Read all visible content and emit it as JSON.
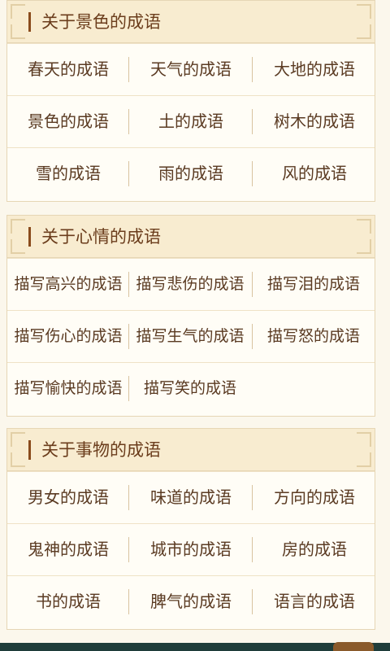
{
  "sections": [
    {
      "title": "关于景色的成语",
      "rows": [
        [
          "春天的成语",
          "天气的成语",
          "大地的成语"
        ],
        [
          "景色的成语",
          "土的成语",
          "树木的成语"
        ],
        [
          "雪的成语",
          "雨的成语",
          "风的成语"
        ]
      ]
    },
    {
      "title": "关于心情的成语",
      "rows": [
        [
          "描写高兴的成语",
          "描写悲伤的成语",
          "描写泪的成语"
        ],
        [
          "描写伤心的成语",
          "描写生气的成语",
          "描写怒的成语"
        ],
        [
          "描写愉快的成语",
          "描写笑的成语",
          ""
        ]
      ]
    },
    {
      "title": "关于事物的成语",
      "rows": [
        [
          "男女的成语",
          "味道的成语",
          "方向的成语"
        ],
        [
          "鬼神的成语",
          "城市的成语",
          "房的成语"
        ],
        [
          "书的成语",
          "脾气的成语",
          "语言的成语"
        ]
      ]
    }
  ],
  "colors": {
    "background": "#fbf7ec",
    "header_bg": "#f8ecd0",
    "title_text": "#6b3d1c",
    "accent_bar": "#8a4b1c",
    "item_text": "#5a3a22",
    "bottom_bar": "#1f3d3a"
  }
}
